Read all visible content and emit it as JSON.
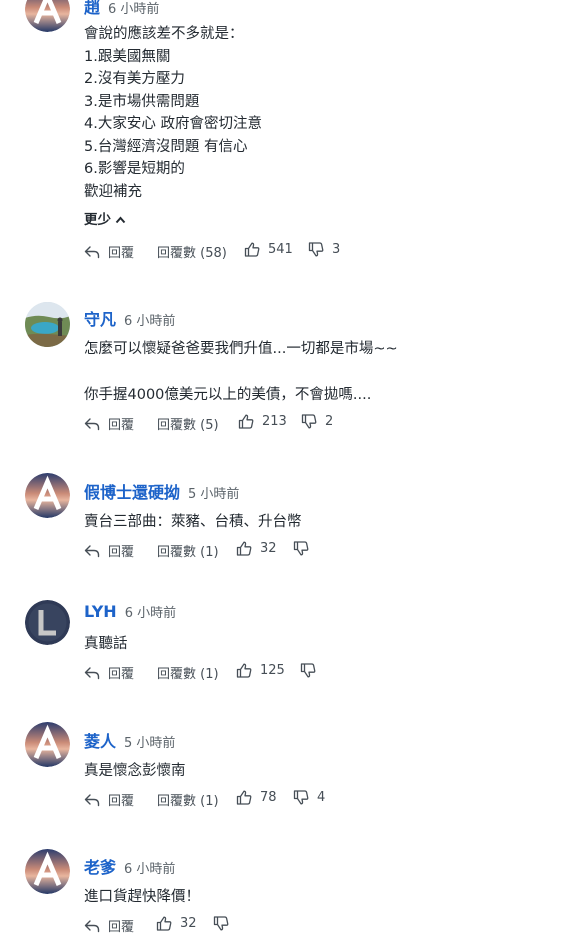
{
  "comments": [
    {
      "author": "趙",
      "time": "6 小時前",
      "lines": [
        "會說的應該差不多就是：",
        "1.跟美國無關",
        "2.沒有美方壓力",
        "3.是市場供需問題",
        "4.大家安心 政府會密切注意",
        "5.台灣經濟沒問題 有信心",
        "6.影響是短期的",
        "歡迎補充"
      ],
      "less_label": "更少",
      "reply_label": "回覆",
      "replies_label": "回覆數 (58)",
      "likes": "541",
      "dislikes": "3"
    },
    {
      "author": "守凡",
      "time": "6 小時前",
      "lines": [
        "怎麼可以懷疑爸爸要我們升值...一切都是市場~~",
        "",
        "你手握4000億美元以上的美債，不會拋嗎...."
      ],
      "reply_label": "回覆",
      "replies_label": "回覆數 (5)",
      "likes": "213",
      "dislikes": "2"
    },
    {
      "author": "假博士還硬拗",
      "time": "5 小時前",
      "lines": [
        "賣台三部曲：萊豬、台積、升台幣"
      ],
      "reply_label": "回覆",
      "replies_label": "回覆數 (1)",
      "likes": "32",
      "dislikes": ""
    },
    {
      "author": "LYH",
      "time": "6 小時前",
      "lines": [
        "真聽話"
      ],
      "reply_label": "回覆",
      "replies_label": "回覆數 (1)",
      "likes": "125",
      "dislikes": ""
    },
    {
      "author": "菱人",
      "time": "5 小時前",
      "lines": [
        "真是懷念彭懷南"
      ],
      "reply_label": "回覆",
      "replies_label": "回覆數 (1)",
      "likes": "78",
      "dislikes": "4"
    },
    {
      "author": "老爹",
      "time": "6 小時前",
      "lines": [
        "進口貨趕快降價！"
      ],
      "reply_label": "回覆",
      "likes": "32",
      "dislikes": ""
    }
  ],
  "colors": {
    "author": "#1d63c9",
    "text": "#232a31",
    "muted": "#5b636a"
  },
  "icons": [
    "default-avatar-icon",
    "reply-arrow-icon",
    "thumbs-up-icon",
    "thumbs-down-icon",
    "chevron-up-icon"
  ]
}
